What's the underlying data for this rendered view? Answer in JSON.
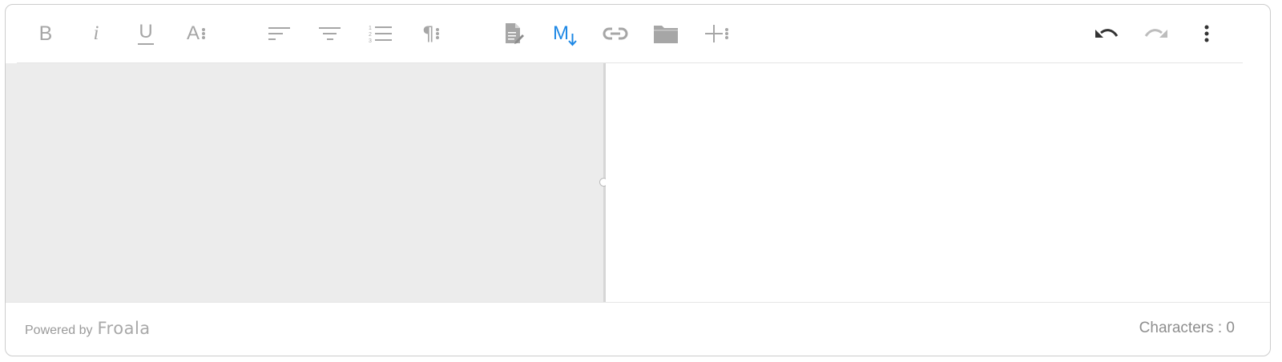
{
  "toolbar": {
    "bold_label": "B",
    "italic_label": "i",
    "underline_label": "U",
    "text_format_label": "A",
    "paragraph_label": "¶",
    "markdown_label": "M"
  },
  "colors": {
    "icon_gray": "#a6a6a6",
    "icon_dark": "#333333",
    "accent_blue": "#1e88e5",
    "left_pane_bg": "#ececec"
  },
  "footer": {
    "powered_by": "Powered by",
    "brand": "Froala",
    "char_count_label": "Characters : 0"
  }
}
